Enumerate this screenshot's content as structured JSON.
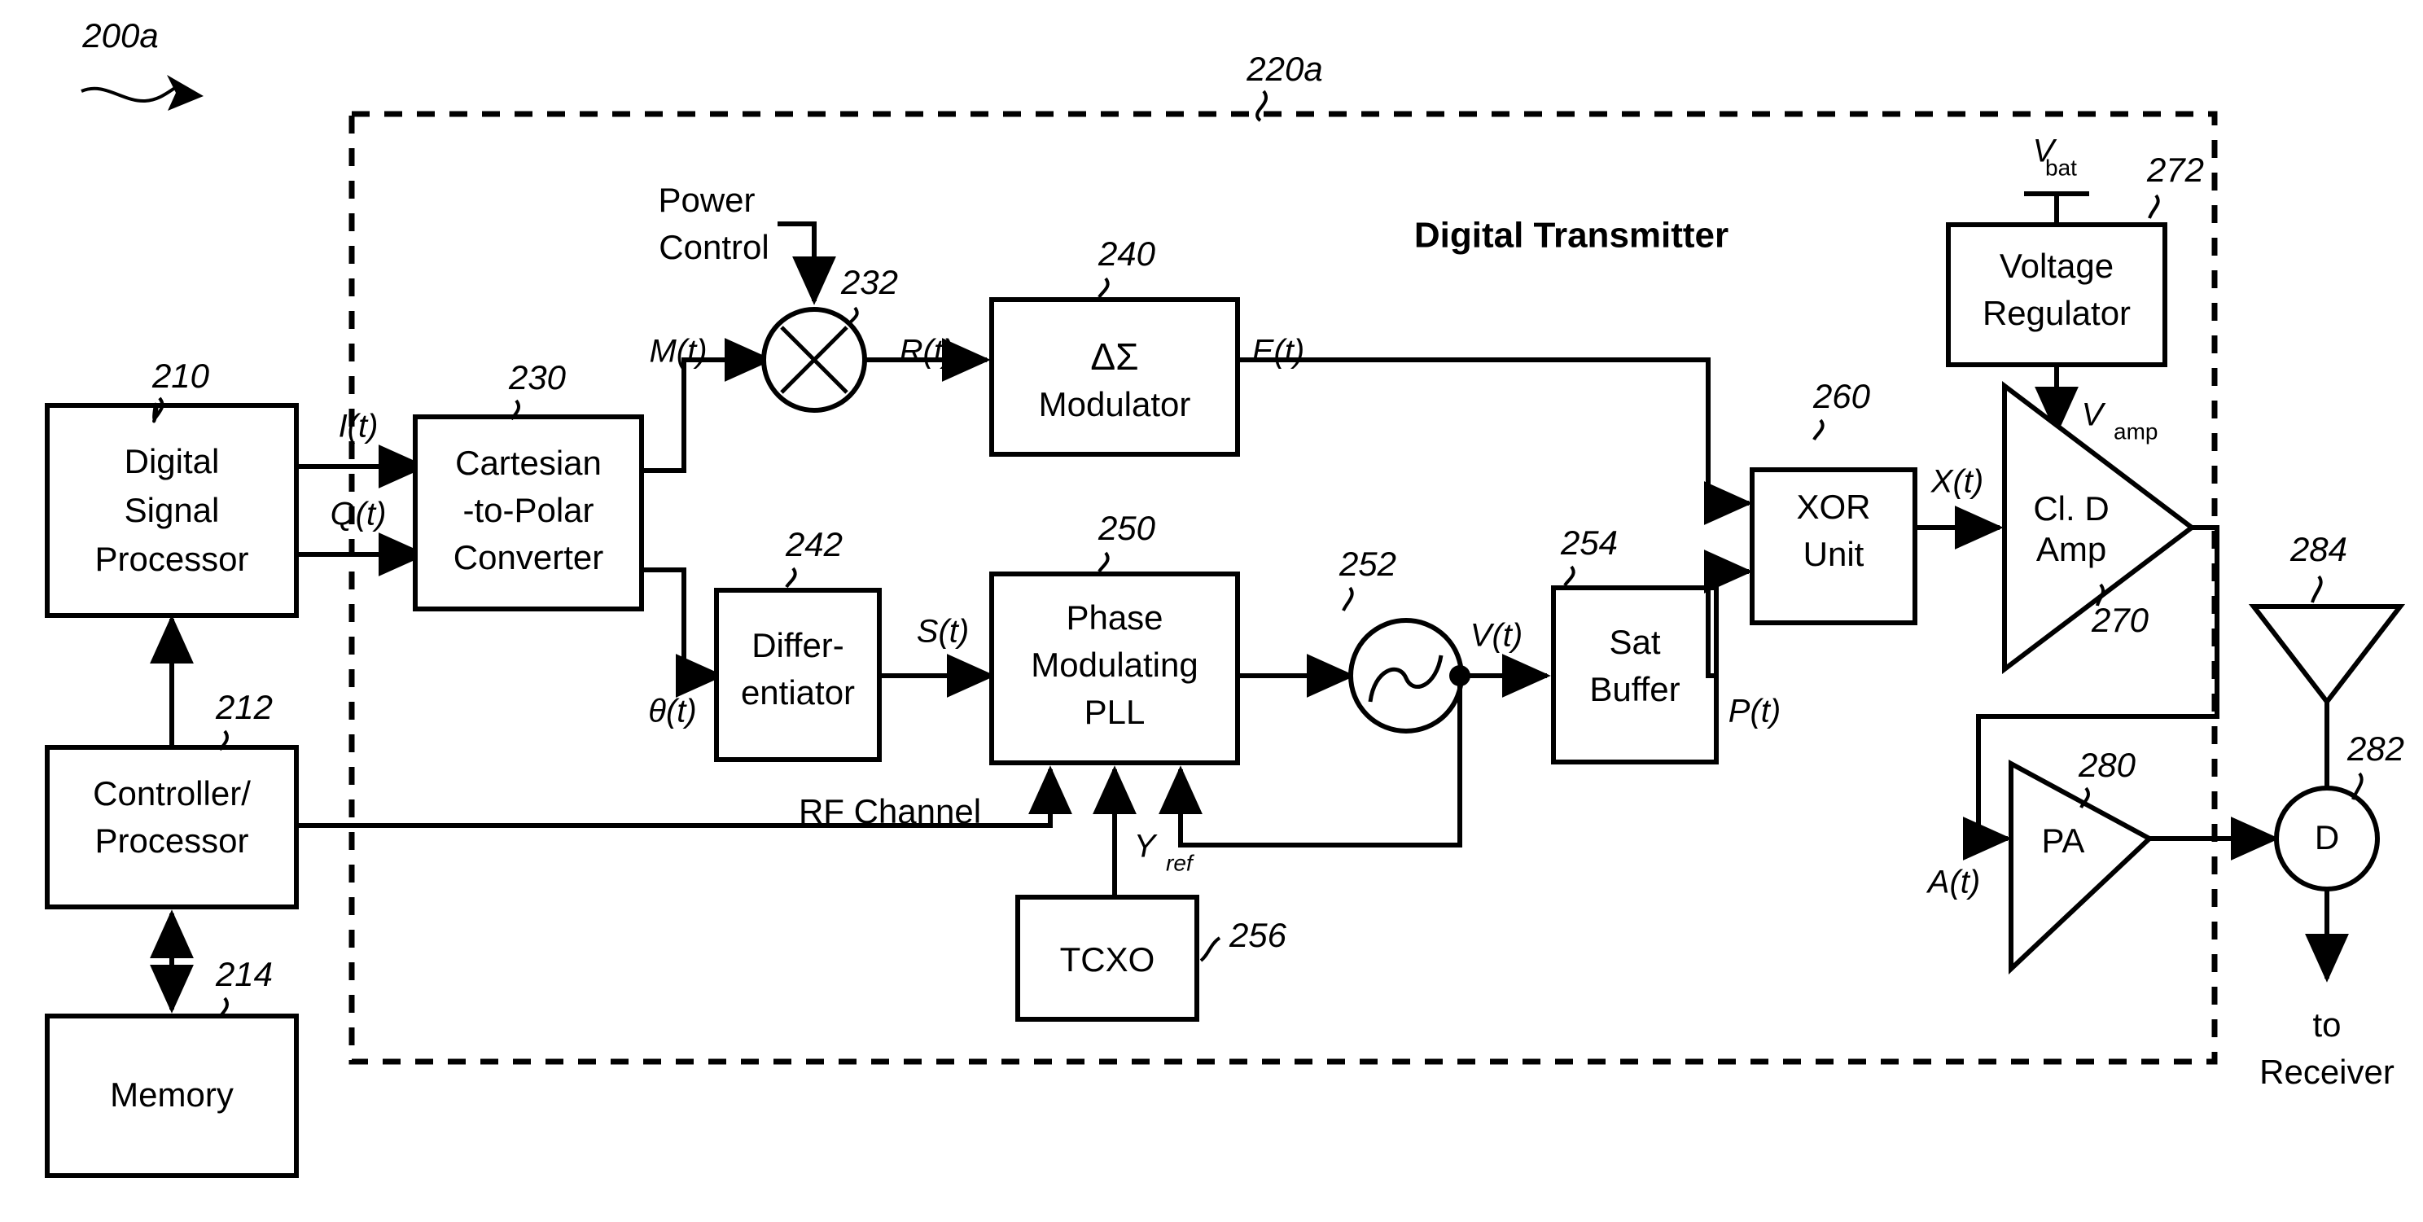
{
  "figure": {
    "ref_main": "200a",
    "ref_boundary": "220a",
    "title": "Digital Transmitter"
  },
  "blocks": {
    "dsp": {
      "label_l1": "Digital",
      "label_l2": "Signal",
      "label_l3": "Processor",
      "ref": "210"
    },
    "controller": {
      "label_l1": "Controller/",
      "label_l2": "Processor",
      "ref": "212"
    },
    "memory": {
      "label": "Memory",
      "ref": "214"
    },
    "c2p": {
      "label_l1": "Cartesian",
      "label_l2": "-to-Polar",
      "label_l3": "Converter",
      "ref": "230"
    },
    "multiplier": {
      "ref": "232",
      "symbol": "multiply-x"
    },
    "sigma_delta": {
      "label_l1": "ΔΣ",
      "label_l2": "Modulator",
      "ref": "240"
    },
    "differentiator": {
      "label_l1": "Differ-",
      "label_l2": "entiator",
      "ref": "242"
    },
    "pll": {
      "label_l1": "Phase",
      "label_l2": "Modulating",
      "label_l3": "PLL",
      "ref": "250"
    },
    "vco": {
      "ref": "252",
      "symbol": "sine-wave"
    },
    "sat_buffer": {
      "label_l1": "Sat",
      "label_l2": "Buffer",
      "ref": "254"
    },
    "tcxo": {
      "label": "TCXO",
      "ref": "256"
    },
    "xor": {
      "label_l1": "XOR",
      "label_l2": "Unit",
      "ref": "260"
    },
    "class_d_amp": {
      "label_l1": "Cl. D",
      "label_l2": "Amp",
      "ref": "270"
    },
    "voltage_regulator": {
      "label_l1": "Voltage",
      "label_l2": "Regulator",
      "ref": "272"
    },
    "pa": {
      "label": "PA",
      "ref": "280"
    },
    "duplexer": {
      "label": "D",
      "ref": "282"
    },
    "antenna": {
      "ref": "284"
    }
  },
  "signals": {
    "i_t": "I(t)",
    "q_t": "Q(t)",
    "m_t": "M(t)",
    "r_t": "R(t)",
    "e_t": "E(t)",
    "theta_t": "θ(t)",
    "s_t": "S(t)",
    "v_t": "V(t)",
    "p_t": "P(t)",
    "x_t": "X(t)",
    "a_t": "A(t)",
    "y_ref_base": "Y",
    "y_ref_sub": "ref",
    "v_bat_base": "V",
    "v_bat_sub": "bat",
    "v_amp_base": "V",
    "v_amp_sub": "amp"
  },
  "annotations": {
    "power_control_l1": "Power",
    "power_control_l2": "Control",
    "rf_channel": "RF Channel",
    "to_receiver_l1": "to",
    "to_receiver_l2": "Receiver"
  },
  "colors": {
    "stroke": "#000000",
    "background": "#ffffff"
  }
}
